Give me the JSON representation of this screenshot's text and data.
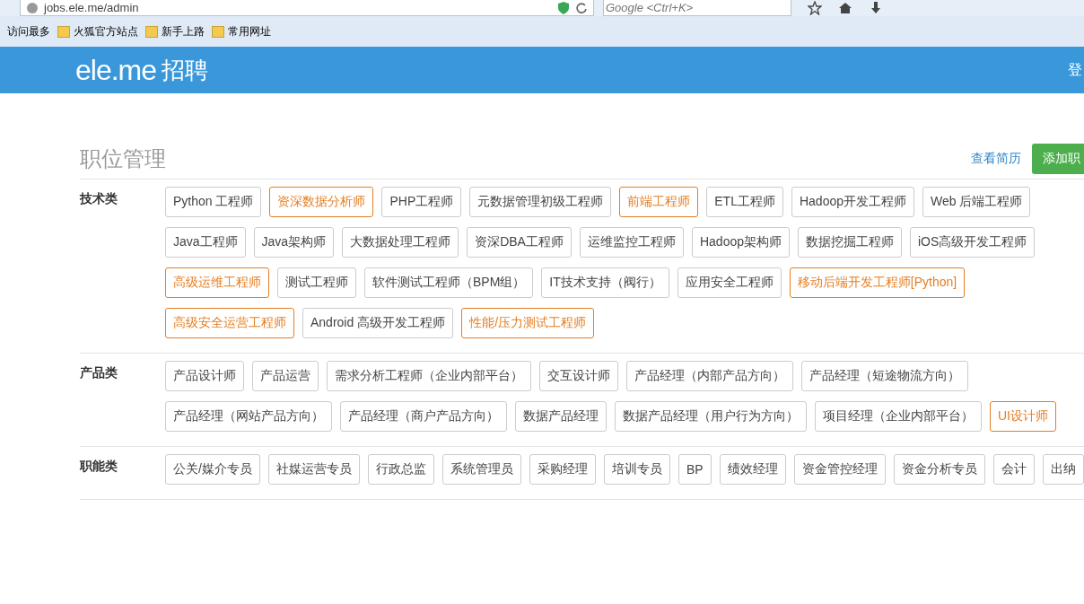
{
  "browser": {
    "url": "jobs.ele.me/admin",
    "search_placeholder": "Google <Ctrl+K>",
    "bookmarks": [
      "访问最多",
      "火狐官方站点",
      "新手上路",
      "常用网址"
    ]
  },
  "header": {
    "logo": "ele.me",
    "logo_suffix": "招聘",
    "login": "登"
  },
  "page": {
    "title": "职位管理",
    "view_resumes": "查看简历",
    "add_button": "添加职"
  },
  "sections": [
    {
      "label": "技术类",
      "tags": [
        {
          "text": "Python 工程师",
          "highlight": false
        },
        {
          "text": "资深数据分析师",
          "highlight": true
        },
        {
          "text": "PHP工程师",
          "highlight": false
        },
        {
          "text": "元数据管理初级工程师",
          "highlight": false
        },
        {
          "text": "前端工程师",
          "highlight": true
        },
        {
          "text": "ETL工程师",
          "highlight": false
        },
        {
          "text": "Hadoop开发工程师",
          "highlight": false
        },
        {
          "text": "Web 后端工程师",
          "highlight": false
        },
        {
          "text": "Java工程师",
          "highlight": false
        },
        {
          "text": "Java架构师",
          "highlight": false
        },
        {
          "text": "大数据处理工程师",
          "highlight": false
        },
        {
          "text": "资深DBA工程师",
          "highlight": false
        },
        {
          "text": "运维监控工程师",
          "highlight": false
        },
        {
          "text": "Hadoop架构师",
          "highlight": false
        },
        {
          "text": "数据挖掘工程师",
          "highlight": false
        },
        {
          "text": "iOS高级开发工程师",
          "highlight": false
        },
        {
          "text": "高级运维工程师",
          "highlight": true
        },
        {
          "text": "测试工程师",
          "highlight": false
        },
        {
          "text": "软件测试工程师（BPM组）",
          "highlight": false
        },
        {
          "text": "IT技术支持（阀行）",
          "highlight": false
        },
        {
          "text": "应用安全工程师",
          "highlight": false
        },
        {
          "text": "移动后端开发工程师[Python]",
          "highlight": true
        },
        {
          "text": "高级安全运营工程师",
          "highlight": true
        },
        {
          "text": "Android 高级开发工程师",
          "highlight": false
        },
        {
          "text": "性能/压力测试工程师",
          "highlight": true
        }
      ]
    },
    {
      "label": "产品类",
      "tags": [
        {
          "text": "产品设计师",
          "highlight": false
        },
        {
          "text": "产品运营",
          "highlight": false
        },
        {
          "text": "需求分析工程师（企业内部平台）",
          "highlight": false
        },
        {
          "text": "交互设计师",
          "highlight": false
        },
        {
          "text": "产品经理（内部产品方向）",
          "highlight": false
        },
        {
          "text": "产品经理（短途物流方向）",
          "highlight": false
        },
        {
          "text": "产品经理（网站产品方向）",
          "highlight": false
        },
        {
          "text": "产品经理（商户产品方向）",
          "highlight": false
        },
        {
          "text": "数据产品经理",
          "highlight": false
        },
        {
          "text": "数据产品经理（用户行为方向）",
          "highlight": false
        },
        {
          "text": "项目经理（企业内部平台）",
          "highlight": false
        },
        {
          "text": "UI设计师",
          "highlight": true
        }
      ]
    },
    {
      "label": "职能类",
      "tags": [
        {
          "text": "公关/媒介专员",
          "highlight": false
        },
        {
          "text": "社媒运营专员",
          "highlight": false
        },
        {
          "text": "行政总监",
          "highlight": false
        },
        {
          "text": "系统管理员",
          "highlight": false
        },
        {
          "text": "采购经理",
          "highlight": false
        },
        {
          "text": "培训专员",
          "highlight": false
        },
        {
          "text": "BP",
          "highlight": false
        },
        {
          "text": "绩效经理",
          "highlight": false
        },
        {
          "text": "资金管控经理",
          "highlight": false
        },
        {
          "text": "资金分析专员",
          "highlight": false
        },
        {
          "text": "会计",
          "highlight": false
        },
        {
          "text": "出纳",
          "highlight": false
        }
      ]
    }
  ]
}
